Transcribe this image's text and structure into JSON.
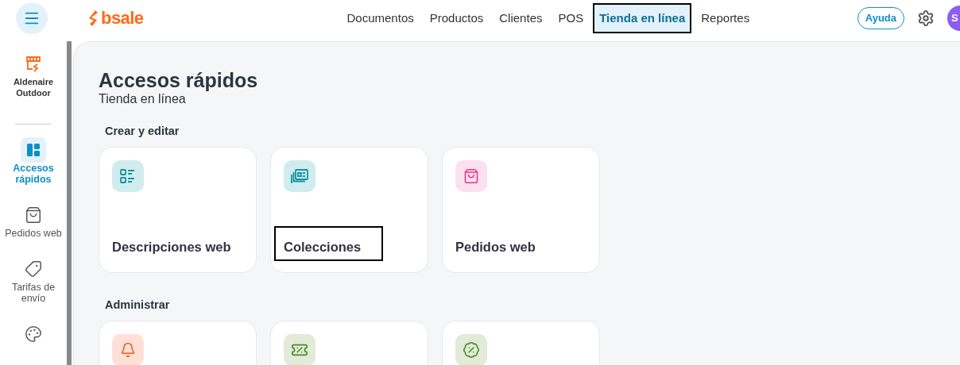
{
  "header": {
    "brand": "bsale",
    "nav": [
      {
        "label": "Documentos",
        "selected": false,
        "highlighted": false
      },
      {
        "label": "Productos",
        "selected": false,
        "highlighted": false
      },
      {
        "label": "Clientes",
        "selected": false,
        "highlighted": false
      },
      {
        "label": "POS",
        "selected": false,
        "highlighted": false
      },
      {
        "label": "Tienda en línea",
        "selected": true,
        "highlighted": true
      },
      {
        "label": "Reportes",
        "selected": false,
        "highlighted": false
      }
    ],
    "help_button": "Ayuda",
    "avatar": "S"
  },
  "sidebar": {
    "store": "Aldenaire Outdoor",
    "items": [
      {
        "kind": "dashboard",
        "label": "Accesos rápidos",
        "selected": true
      },
      {
        "kind": "bag",
        "label": "Pedidos web",
        "selected": false
      },
      {
        "kind": "tag",
        "label": "Tarifas de envío",
        "selected": false
      },
      {
        "kind": "palette",
        "selected": false
      }
    ]
  },
  "page": {
    "title": "Accesos rápidos",
    "subtitle": "Tienda en línea",
    "sections": [
      {
        "title": "Crear y editar",
        "cards": [
          {
            "kind": "list",
            "label": "Descripciones web",
            "color": "#d0ecef",
            "highlighted": false
          },
          {
            "kind": "collection",
            "label": "Colecciones",
            "color": "#d0ecef",
            "highlighted": true
          },
          {
            "kind": "bag",
            "label": "Pedidos web",
            "color": "#fde0ee",
            "highlighted": false
          }
        ]
      },
      {
        "title": "Administrar",
        "cards": [
          {
            "kind": "bell",
            "color": "#ffe0d6"
          },
          {
            "kind": "ticket",
            "color": "#e1ebd7"
          },
          {
            "kind": "badge",
            "color": "#e1ebd7"
          }
        ]
      }
    ]
  }
}
